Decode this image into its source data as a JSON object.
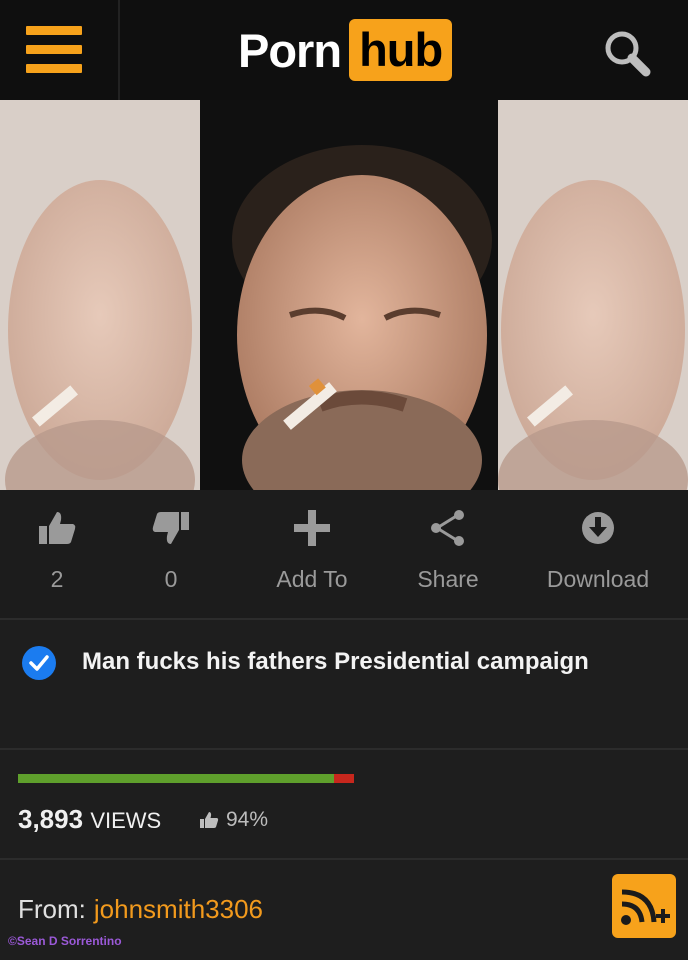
{
  "header": {
    "logo_left": "Porn",
    "logo_right": "hub",
    "menu_icon": "hamburger-menu-icon",
    "search_icon": "search-icon",
    "accent_color": "#f7a21b"
  },
  "thumbnail": {
    "description_icon": "video-thumbnail"
  },
  "actions": [
    {
      "label": "2",
      "icon": "thumbs-up-icon"
    },
    {
      "label": "0",
      "icon": "thumbs-down-icon"
    },
    {
      "label": "Add To",
      "icon": "plus-icon"
    },
    {
      "label": "Share",
      "icon": "share-icon"
    },
    {
      "label": "Download",
      "icon": "download-icon"
    }
  ],
  "video": {
    "title": "Man fucks his fathers Presidential campaign",
    "verified_icon": "verified-check-icon",
    "views_count": "3,893",
    "views_word": "VIEWS",
    "rating_percent": "94%",
    "rating_fraction": 0.94,
    "rating_good_color": "#5fa02c",
    "rating_bad_color": "#c7271d"
  },
  "uploader": {
    "from_label": "From:",
    "username": "johnsmith3306",
    "subscribe_icon": "rss-subscribe-icon"
  },
  "watermark": "©Sean D Sorrentino"
}
